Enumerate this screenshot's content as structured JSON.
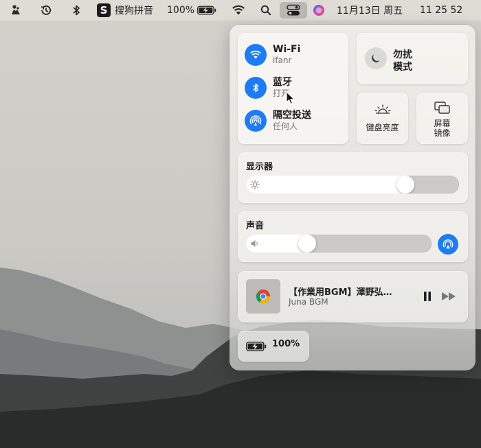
{
  "menubar": {
    "sogou_label": "搜狗拼音",
    "sogou_badge": "S",
    "battery_percent": "100%",
    "date": "11月13日 周五",
    "time": "11 25 52"
  },
  "control_center": {
    "network": {
      "wifi": {
        "title": "Wi-Fi",
        "subtitle": "ifanr"
      },
      "bluetooth": {
        "title": "蓝牙",
        "subtitle": "打开"
      },
      "airdrop": {
        "title": "隔空投送",
        "subtitle": "任何人"
      }
    },
    "dnd": {
      "line1": "勿扰",
      "line2": "模式"
    },
    "keyboard_brightness": {
      "label": "键盘亮度"
    },
    "screen_mirroring": {
      "line1": "屏幕",
      "line2": "镜像"
    },
    "display": {
      "title": "显示器",
      "level": 0.77
    },
    "sound": {
      "title": "声音",
      "level": 0.31
    },
    "now_playing": {
      "title": "【作業用BGM】澤野弘…",
      "artist": "Juna BGM"
    },
    "battery": {
      "percent": "100%"
    }
  },
  "colors": {
    "accent_blue": "#1d7cf2",
    "panel_bg": "#efede8"
  },
  "icons": {
    "menubar": [
      "user-switch-icon",
      "time-machine-icon",
      "bluetooth-icon",
      "sogou-input-icon",
      "battery-charging-icon",
      "wifi-icon",
      "search-icon",
      "control-center-icon",
      "siri-icon"
    ],
    "panel": [
      "wifi-icon",
      "bluetooth-icon",
      "airdrop-icon",
      "moon-icon",
      "keyboard-brightness-icon",
      "screen-mirroring-icon",
      "sun-icon",
      "speaker-icon",
      "airplay-audio-icon",
      "chrome-icon",
      "pause-icon",
      "fast-forward-icon",
      "battery-charging-icon"
    ]
  }
}
